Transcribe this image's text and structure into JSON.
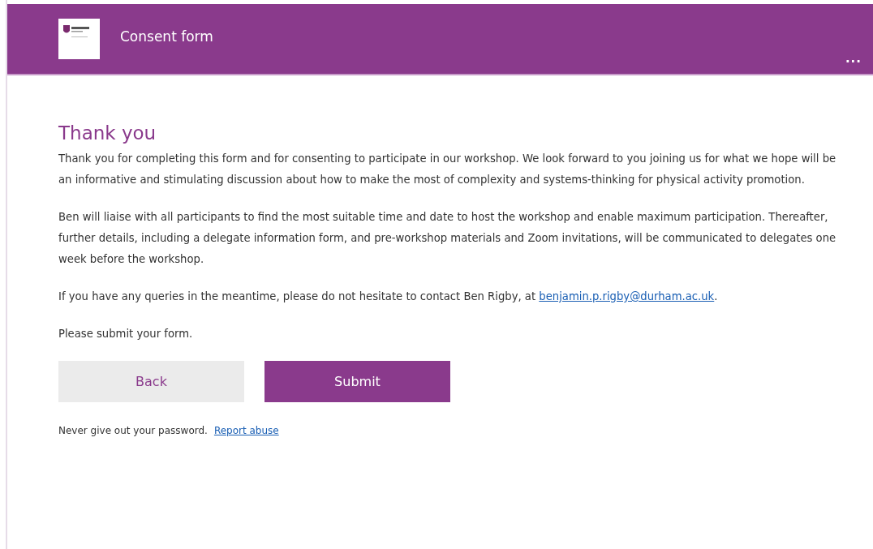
{
  "header": {
    "title": "Consent form",
    "more": "..."
  },
  "heading": "Thank you",
  "paragraphs": [
    {
      "text": "Thank you for completing this form and for consenting to participate in our workshop. We look forward to you joining us for what we hope will be an informative and stimulating discussion about how to make the most of complexity and systems-thinking for physical activity promotion."
    },
    {
      "text": "Ben will liaise with all participants to find the most suitable time and date to host the workshop and enable maximum participation. Thereafter, further details, including a delegate information form, and pre-workshop materials and Zoom invitations, will be communicated to delegates one week before the workshop."
    },
    {
      "text": "If you have any queries in the meantime, please do not hesitate to contact Ben Rigby, at ",
      "link": "benjamin.p.rigby@durham.ac.uk",
      "tail": "."
    },
    {
      "text": "Please submit your form."
    }
  ],
  "buttons": [
    {
      "label": "Back",
      "kind": "secondary"
    },
    {
      "label": "Submit",
      "kind": "primary"
    }
  ],
  "footer": {
    "text": "Never give out your password.",
    "link": "Report abuse"
  }
}
